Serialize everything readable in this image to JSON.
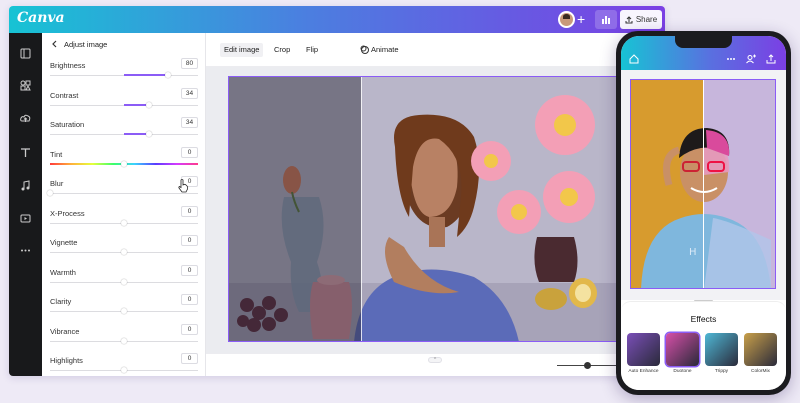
{
  "app": {
    "logo": "Canva",
    "share_label": "Share",
    "plus": "+"
  },
  "sidebar_icons": [
    "panel-icon",
    "elements-icon",
    "uploads-icon",
    "text-icon",
    "audio-icon",
    "video-icon",
    "more-icon"
  ],
  "panel": {
    "title": "Adjust image",
    "adjustments": [
      {
        "label": "Brightness",
        "value": "80",
        "level": 0.8,
        "type": "slider"
      },
      {
        "label": "Contrast",
        "value": "34",
        "level": 0.67,
        "type": "slider"
      },
      {
        "label": "Saturation",
        "value": "34",
        "level": 0.67,
        "type": "slider"
      },
      {
        "label": "Tint",
        "value": "0",
        "level": 0.5,
        "type": "rainbow"
      },
      {
        "label": "Blur",
        "value": "0",
        "level": 0.0,
        "type": "slider"
      },
      {
        "label": "X-Process",
        "value": "0",
        "level": 0.5,
        "type": "slider"
      },
      {
        "label": "Vignette",
        "value": "0",
        "level": 0.5,
        "type": "slider"
      },
      {
        "label": "Warmth",
        "value": "0",
        "level": 0.5,
        "type": "slider"
      },
      {
        "label": "Clarity",
        "value": "0",
        "level": 0.5,
        "type": "slider"
      },
      {
        "label": "Vibrance",
        "value": "0",
        "level": 0.5,
        "type": "slider"
      },
      {
        "label": "Highlights",
        "value": "0",
        "level": 0.5,
        "type": "slider"
      }
    ]
  },
  "toolbar": {
    "edit_image": "Edit image",
    "crop": "Crop",
    "flip": "Flip",
    "animate": "Animate"
  },
  "bottom": {
    "page_handle": "^"
  },
  "phone": {
    "effects_title": "Effects",
    "effects": [
      {
        "label": "Auto Enhance",
        "color": "#7a4fb8"
      },
      {
        "label": "Duotone",
        "color": "#d64fa8"
      },
      {
        "label": "Trippy",
        "color": "#4fb8d6"
      },
      {
        "label": "ColorMix",
        "color": "#c9a04a"
      }
    ]
  },
  "colors": {
    "accent": "#8b5cf6",
    "rail": "#18191b"
  }
}
